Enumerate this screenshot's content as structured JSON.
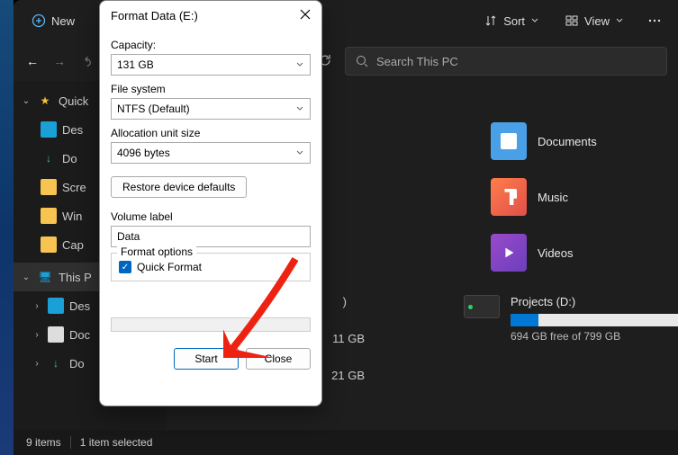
{
  "toolbar": {
    "new_label": "New",
    "sort_label": "Sort",
    "view_label": "View"
  },
  "nav": {
    "search_placeholder": "Search This PC"
  },
  "sidebar": {
    "quick": "Quick",
    "items": [
      "Des",
      "Do",
      "Scre",
      "Win",
      "Cap"
    ],
    "this_pc": "This P",
    "pc_items": [
      "Des",
      "Doc",
      "Do"
    ]
  },
  "content": {
    "folders": {
      "documents": "Documents",
      "music": "Music",
      "videos": "Videos"
    },
    "peek": {
      "paren": ")",
      "drive_c_size": "11 GB",
      "drive_e_size": "21 GB"
    },
    "drive_d": {
      "title": "Projects (D:)",
      "free": "694 GB free of 799 GB",
      "fill_pct": 13
    }
  },
  "status": {
    "count": "9 items",
    "selected": "1 item selected"
  },
  "dialog": {
    "title": "Format Data (E:)",
    "capacity_lbl": "Capacity:",
    "capacity_val": "131 GB",
    "fs_lbl": "File system",
    "fs_val": "NTFS (Default)",
    "alloc_lbl": "Allocation unit size",
    "alloc_val": "4096 bytes",
    "restore": "Restore device defaults",
    "vol_lbl": "Volume label",
    "vol_val": "Data",
    "opts_lbl": "Format options",
    "quick": "Quick Format",
    "start": "Start",
    "close": "Close"
  }
}
